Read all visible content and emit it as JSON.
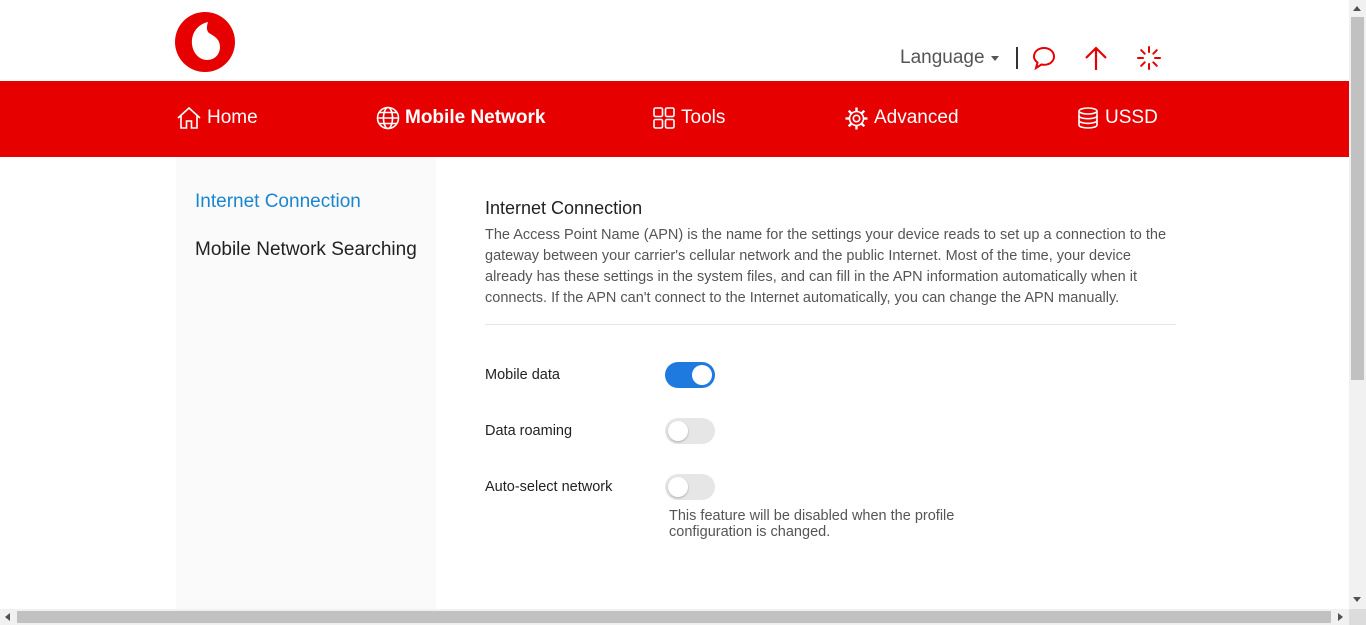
{
  "header": {
    "language_label": "Language",
    "icons": [
      "vodafone-logo",
      "message-icon",
      "upload-arrow-icon",
      "loading-spinner-icon"
    ]
  },
  "nav": {
    "items": [
      {
        "label": "Home",
        "icon": "home-icon"
      },
      {
        "label": "Mobile Network",
        "icon": "globe-icon",
        "active": true
      },
      {
        "label": "Tools",
        "icon": "tools-grid-icon"
      },
      {
        "label": "Advanced",
        "icon": "gear-icon"
      },
      {
        "label": "USSD",
        "icon": "database-icon"
      }
    ]
  },
  "sidebar": {
    "items": [
      {
        "label": "Internet Connection",
        "active": true
      },
      {
        "label": "Mobile Network Searching"
      }
    ]
  },
  "main": {
    "title": "Internet Connection",
    "description": "The Access Point Name (APN) is the name for the settings your device reads to set up a connection to the gateway between your carrier's cellular network and the public Internet. Most of the time, your device already has these settings in the system files, and can fill in the APN information automatically when it connects. If the APN can't connect to the Internet automatically, you can change the APN manually.",
    "settings": [
      {
        "label": "Mobile data",
        "enabled": true
      },
      {
        "label": "Data roaming",
        "enabled": false
      },
      {
        "label": "Auto-select network",
        "enabled": false
      }
    ],
    "auto_select_note": "This feature will be disabled when the profile configuration is changed."
  },
  "colors": {
    "brand_red": "#e60000",
    "active_link_blue": "#1a86d0",
    "toggle_on_blue": "#1f7ae0"
  }
}
